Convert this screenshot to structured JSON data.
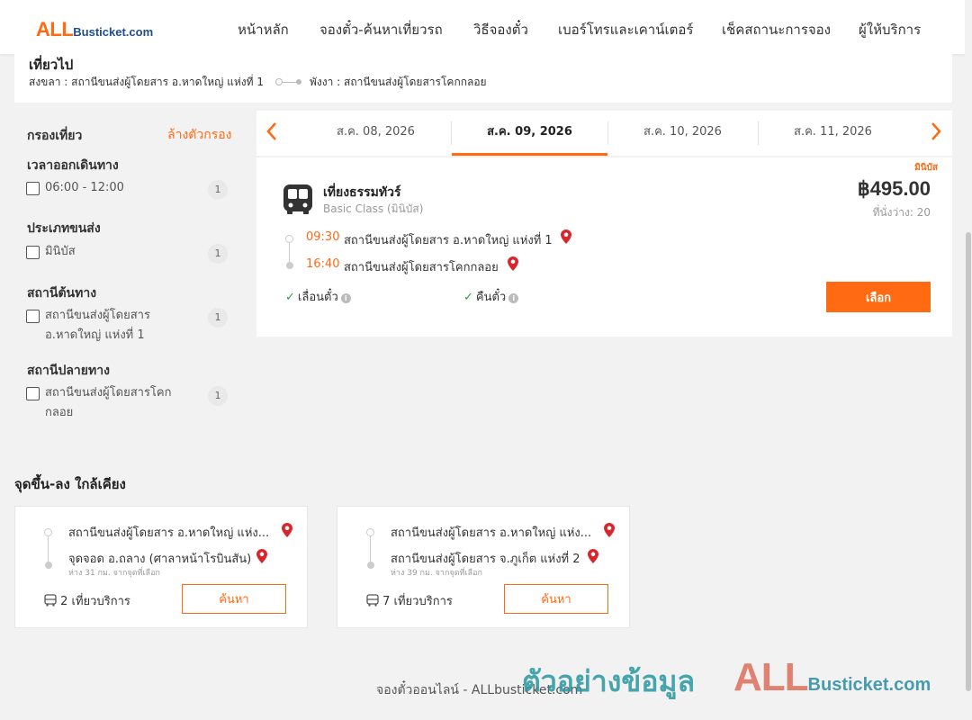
{
  "header": {
    "logo_all": "ALL",
    "logo_rest": "Busticket.com",
    "nav": [
      "หน้าหลัก",
      "จองตั๋ว-ค้นหาเที่ยวรถ",
      "วิธีจองตั๋ว",
      "เบอร์โทรและเคาน์เตอร์",
      "เช็คสถานะการจอง",
      "ผู้ให้บริการ"
    ]
  },
  "trip": {
    "title": "เที่ยวไป",
    "from": "สงขลา : สถานีขนส่งผู้โดยสาร อ.หาดใหญ่ แห่งที่ 1",
    "to": "พังงา : สถานีขนส่งผู้โดยสารโคกกลอย"
  },
  "filters": {
    "title": "กรองเที่ยว",
    "clear": "ล้างตัวกรอง",
    "groups": [
      {
        "title": "เวลาออกเดินทาง",
        "option": "06:00 - 12:00",
        "count": "1"
      },
      {
        "title": "ประเภทขนส่ง",
        "option": "มินิบัส",
        "count": "1"
      },
      {
        "title": "สถานีต้นทาง",
        "option": "สถานีขนส่งผู้โดยสาร อ.หาดใหญ่ แห่งที่ 1",
        "count": "1"
      },
      {
        "title": "สถานีปลายทาง",
        "option": "สถานีขนส่งผู้โดยสารโคกกลอย",
        "count": "1"
      }
    ]
  },
  "dates": {
    "prev": "‹",
    "next": "›",
    "tabs": [
      "ส.ค. 08, 2026",
      "ส.ค. 09, 2026",
      "ส.ค. 10, 2026",
      "ส.ค. 11, 2026"
    ]
  },
  "result": {
    "tag": "มินิบัส",
    "operator": "เที่ยงธรรมทัวร์",
    "class": "Basic Class (มินิบัส)",
    "price": "฿495.00",
    "seats": "ที่นั่งว่าง: 20",
    "depart_time": "09:30",
    "depart_station": "สถานีขนส่งผู้โดยสาร อ.หาดใหญ่ แห่งที่ 1",
    "arrive_time": "16:40",
    "arrive_station": "สถานีขนส่งผู้โดยสารโคกกลอย",
    "feature1": "เลื่อนตั๋ว",
    "feature2": "คืนตั๋ว",
    "select_label": "เลือก"
  },
  "nearby": {
    "title": "จุดขึ้น-ลง ใกล้เคียง",
    "cards": [
      {
        "from": "สถานีขนส่งผู้โดยสาร อ.หาดใหญ่ แห่ง...",
        "to": "จุดจอด อ.ถลาง (ศาลาหน้าโรบินสัน)",
        "distance": "ห่าง 31 กม. จากจุดที่เลือก",
        "trips": "2 เที่ยวบริการ",
        "button": "ค้นหา"
      },
      {
        "from": "สถานีขนส่งผู้โดยสาร อ.หาดใหญ่ แห่ง...",
        "to": "สถานีขนส่งผู้โดยสาร จ.ภูเก็ต แห่งที่ 2",
        "distance": "ห่าง 39 กม. จากจุดที่เลือก",
        "trips": "7 เที่ยวบริการ",
        "button": "ค้นหา"
      }
    ]
  },
  "footer": {
    "text": "จองตั๋วออนไลน์ - ALLbusticket.com",
    "watermark_text": "ตัวอย่างข้อมูล",
    "watermark_logo_all": "ALL",
    "watermark_logo_rest": "Busticket.com"
  },
  "colors": {
    "accent": "#ff6a13",
    "brand_blue": "#1f4e8c",
    "check_green": "#2e9e44"
  }
}
